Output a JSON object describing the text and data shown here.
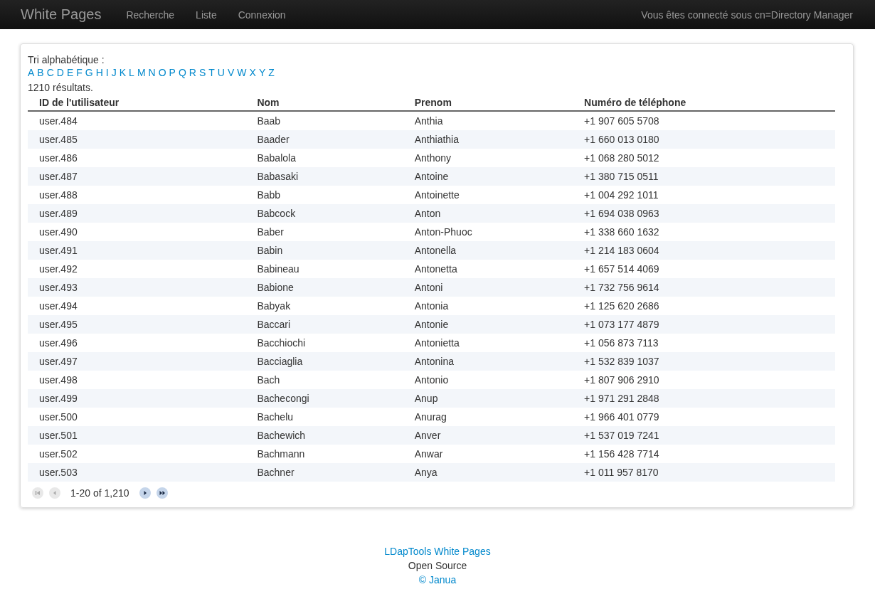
{
  "navbar": {
    "brand": "White Pages",
    "links": [
      "Recherche",
      "Liste",
      "Connexion"
    ],
    "user_text": "Vous êtes connecté sous cn=Directory Manager"
  },
  "sort": {
    "label": "Tri alphabétique :",
    "letters": [
      "A",
      "B",
      "C",
      "D",
      "E",
      "F",
      "G",
      "H",
      "I",
      "J",
      "K",
      "L",
      "M",
      "N",
      "O",
      "P",
      "Q",
      "R",
      "S",
      "T",
      "U",
      "V",
      "W",
      "X",
      "Y",
      "Z"
    ]
  },
  "result_count": "1210 résultats.",
  "table": {
    "columns": [
      "ID de l'utilisateur",
      "Nom",
      "Prenom",
      "Numéro de téléphone"
    ],
    "rows": [
      [
        "user.484",
        "Baab",
        "Anthia",
        "+1 907 605 5708"
      ],
      [
        "user.485",
        "Baader",
        "Anthiathia",
        "+1 660 013 0180"
      ],
      [
        "user.486",
        "Babalola",
        "Anthony",
        "+1 068 280 5012"
      ],
      [
        "user.487",
        "Babasaki",
        "Antoine",
        "+1 380 715 0511"
      ],
      [
        "user.488",
        "Babb",
        "Antoinette",
        "+1 004 292 1011"
      ],
      [
        "user.489",
        "Babcock",
        "Anton",
        "+1 694 038 0963"
      ],
      [
        "user.490",
        "Baber",
        "Anton-Phuoc",
        "+1 338 660 1632"
      ],
      [
        "user.491",
        "Babin",
        "Antonella",
        "+1 214 183 0604"
      ],
      [
        "user.492",
        "Babineau",
        "Antonetta",
        "+1 657 514 4069"
      ],
      [
        "user.493",
        "Babione",
        "Antoni",
        "+1 732 756 9614"
      ],
      [
        "user.494",
        "Babyak",
        "Antonia",
        "+1 125 620 2686"
      ],
      [
        "user.495",
        "Baccari",
        "Antonie",
        "+1 073 177 4879"
      ],
      [
        "user.496",
        "Bacchiochi",
        "Antonietta",
        "+1 056 873 7113"
      ],
      [
        "user.497",
        "Bacciaglia",
        "Antonina",
        "+1 532 839 1037"
      ],
      [
        "user.498",
        "Bach",
        "Antonio",
        "+1 807 906 2910"
      ],
      [
        "user.499",
        "Bachecongi",
        "Anup",
        "+1 971 291 2848"
      ],
      [
        "user.500",
        "Bachelu",
        "Anurag",
        "+1 966 401 0779"
      ],
      [
        "user.501",
        "Bachewich",
        "Anver",
        "+1 537 019 7241"
      ],
      [
        "user.502",
        "Bachmann",
        "Anwar",
        "+1 156 428 7714"
      ],
      [
        "user.503",
        "Bachner",
        "Anya",
        "+1 011 957 8170"
      ]
    ]
  },
  "pager": {
    "buttons": [
      {
        "kind": "first",
        "disabled": true
      },
      {
        "kind": "prev",
        "disabled": true
      },
      {
        "kind": "next",
        "disabled": false
      },
      {
        "kind": "last",
        "disabled": false
      }
    ],
    "range": "1-20 of 1,210"
  },
  "footer": {
    "link": "LDapTools White Pages",
    "text": "Open Source",
    "copyright": "© Janua"
  }
}
